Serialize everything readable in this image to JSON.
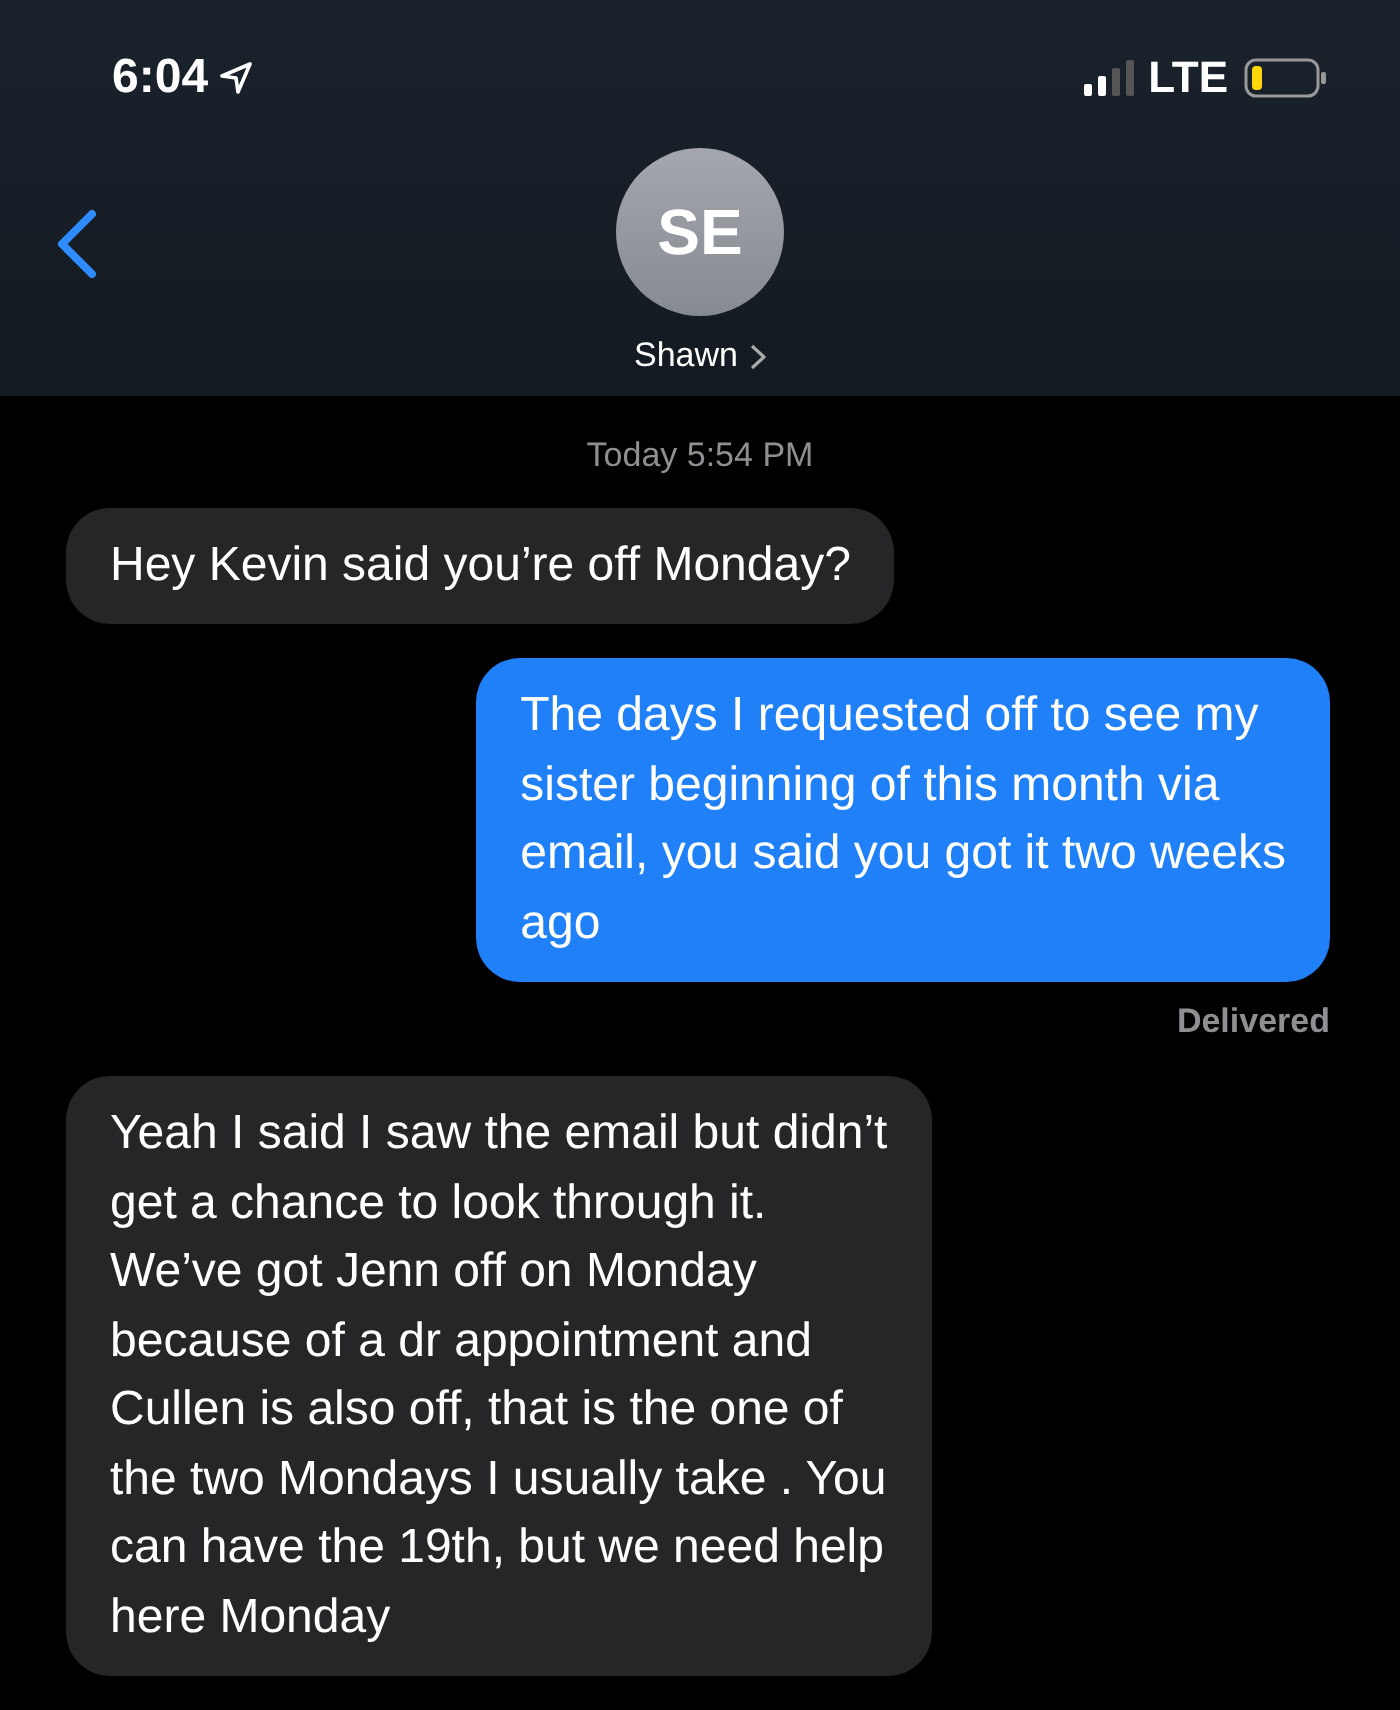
{
  "status_bar": {
    "time": "6:04",
    "network": "LTE"
  },
  "header": {
    "avatar_initials": "SE",
    "contact_name": "Shawn"
  },
  "timestamp": "Today 5:54 PM",
  "messages": [
    {
      "kind": "received",
      "text": "Hey Kevin said you’re off Monday?"
    },
    {
      "kind": "sent",
      "text": "The days I requested off to see my\nsister beginning of this month via\nemail, you said you got it two weeks\nago",
      "status": "Delivered"
    },
    {
      "kind": "received",
      "text": "Yeah I said I saw the email but didn’t\nget a chance to look through it.\nWe’ve got Jenn off on Monday\nbecause of a dr appointment and\nCullen is also off, that is the one of\nthe two Mondays I usually take . You\ncan have the 19th, but we need help\nhere Monday"
    }
  ]
}
